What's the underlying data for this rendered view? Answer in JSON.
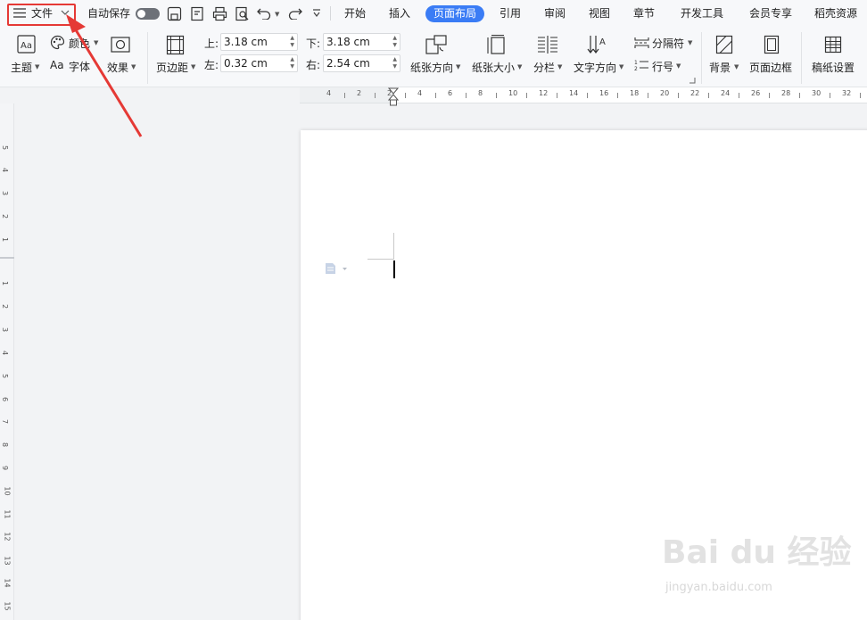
{
  "topbar": {
    "file_label": "文件",
    "autosave_label": "自动保存",
    "tabs": [
      "开始",
      "插入",
      "页面布局",
      "引用",
      "审阅",
      "视图",
      "章节",
      "开发工具",
      "会员专享",
      "稻壳资源"
    ],
    "active_tab": "页面布局"
  },
  "ribbon": {
    "theme_label": "主题",
    "color_label": "颜色",
    "font_label": "字体",
    "effect_label": "效果",
    "margin_label": "页边距",
    "margin_top_label": "上:",
    "margin_top_value": "3.18 cm",
    "margin_bottom_label": "下:",
    "margin_bottom_value": "3.18 cm",
    "margin_left_label": "左:",
    "margin_left_value": "0.32 cm",
    "margin_right_label": "右:",
    "margin_right_value": "2.54 cm",
    "orientation_label": "纸张方向",
    "size_label": "纸张大小",
    "columns_label": "分栏",
    "text_direction_label": "文字方向",
    "breaks_label": "分隔符",
    "line_numbers_label": "行号",
    "background_label": "背景",
    "page_border_label": "页面边框",
    "manuscript_label": "稿纸设置"
  },
  "hruler_numbers": [
    "4",
    "2",
    "2",
    "4",
    "6",
    "8",
    "10",
    "12",
    "14",
    "16",
    "18",
    "20",
    "22",
    "24",
    "26",
    "28",
    "30",
    "32"
  ],
  "vruler_numbers": [
    "5",
    "4",
    "3",
    "2",
    "1",
    "1",
    "2",
    "3",
    "4",
    "5",
    "6",
    "7",
    "8",
    "9",
    "10",
    "11",
    "12",
    "13",
    "14",
    "15"
  ],
  "watermark": {
    "text": "Bai du 经验",
    "sub": "jingyan.baidu.com"
  },
  "colors": {
    "accent": "#3a7cf5",
    "annotation": "#e53935"
  }
}
